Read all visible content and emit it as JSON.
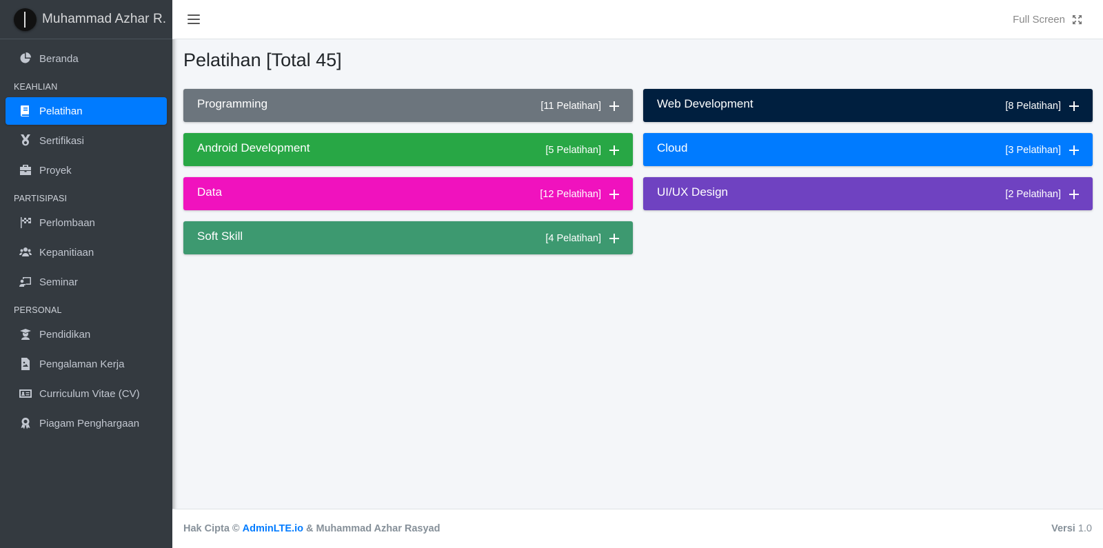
{
  "brand": {
    "name": "Muhammad Azhar R."
  },
  "sidebar": {
    "items": [
      {
        "label": "Beranda",
        "icon": "chart-pie-icon"
      },
      {
        "header": "KEAHLIAN"
      },
      {
        "label": "Pelatihan",
        "icon": "book-icon",
        "active": true
      },
      {
        "label": "Sertifikasi",
        "icon": "medal-icon"
      },
      {
        "label": "Proyek",
        "icon": "briefcase-icon"
      },
      {
        "header": "PARTISIPASI"
      },
      {
        "label": "Perlombaan",
        "icon": "flag-checkered-icon"
      },
      {
        "label": "Kepanitiaan",
        "icon": "users-icon"
      },
      {
        "label": "Seminar",
        "icon": "chalkboard-teacher-icon"
      },
      {
        "header": "PERSONAL"
      },
      {
        "label": "Pendidikan",
        "icon": "graduate-icon"
      },
      {
        "label": "Pengalaman Kerja",
        "icon": "file-image-icon"
      },
      {
        "label": "Curriculum Vitae (CV)",
        "icon": "id-card-icon"
      },
      {
        "label": "Piagam Penghargaan",
        "icon": "award-icon"
      }
    ]
  },
  "topbar": {
    "fullscreen_label": "Full Screen"
  },
  "page": {
    "title": "Pelatihan [Total 45]"
  },
  "cards": [
    {
      "title": "Programming",
      "count": "[11 Pelatihan]",
      "color": "#6c757d"
    },
    {
      "title": "Web Development",
      "count": "[8 Pelatihan]",
      "color": "#001f3f"
    },
    {
      "title": "Android Development",
      "count": "[5 Pelatihan]",
      "color": "#28a745"
    },
    {
      "title": "Cloud",
      "count": "[3 Pelatihan]",
      "color": "#007bff"
    },
    {
      "title": "Data",
      "count": "[12 Pelatihan]",
      "color": "#f012be"
    },
    {
      "title": "UI/UX Design",
      "count": "[2 Pelatihan]",
      "color": "#6f42c1"
    },
    {
      "title": "Soft Skill",
      "count": "[4 Pelatihan]",
      "color": "#3d9970"
    }
  ],
  "footer": {
    "prefix": "Hak Cipta ©",
    "link": "AdminLTE.io",
    "suffix": "& Muhammad Azhar Rasyad",
    "version_label": "Versi",
    "version": "1.0"
  }
}
